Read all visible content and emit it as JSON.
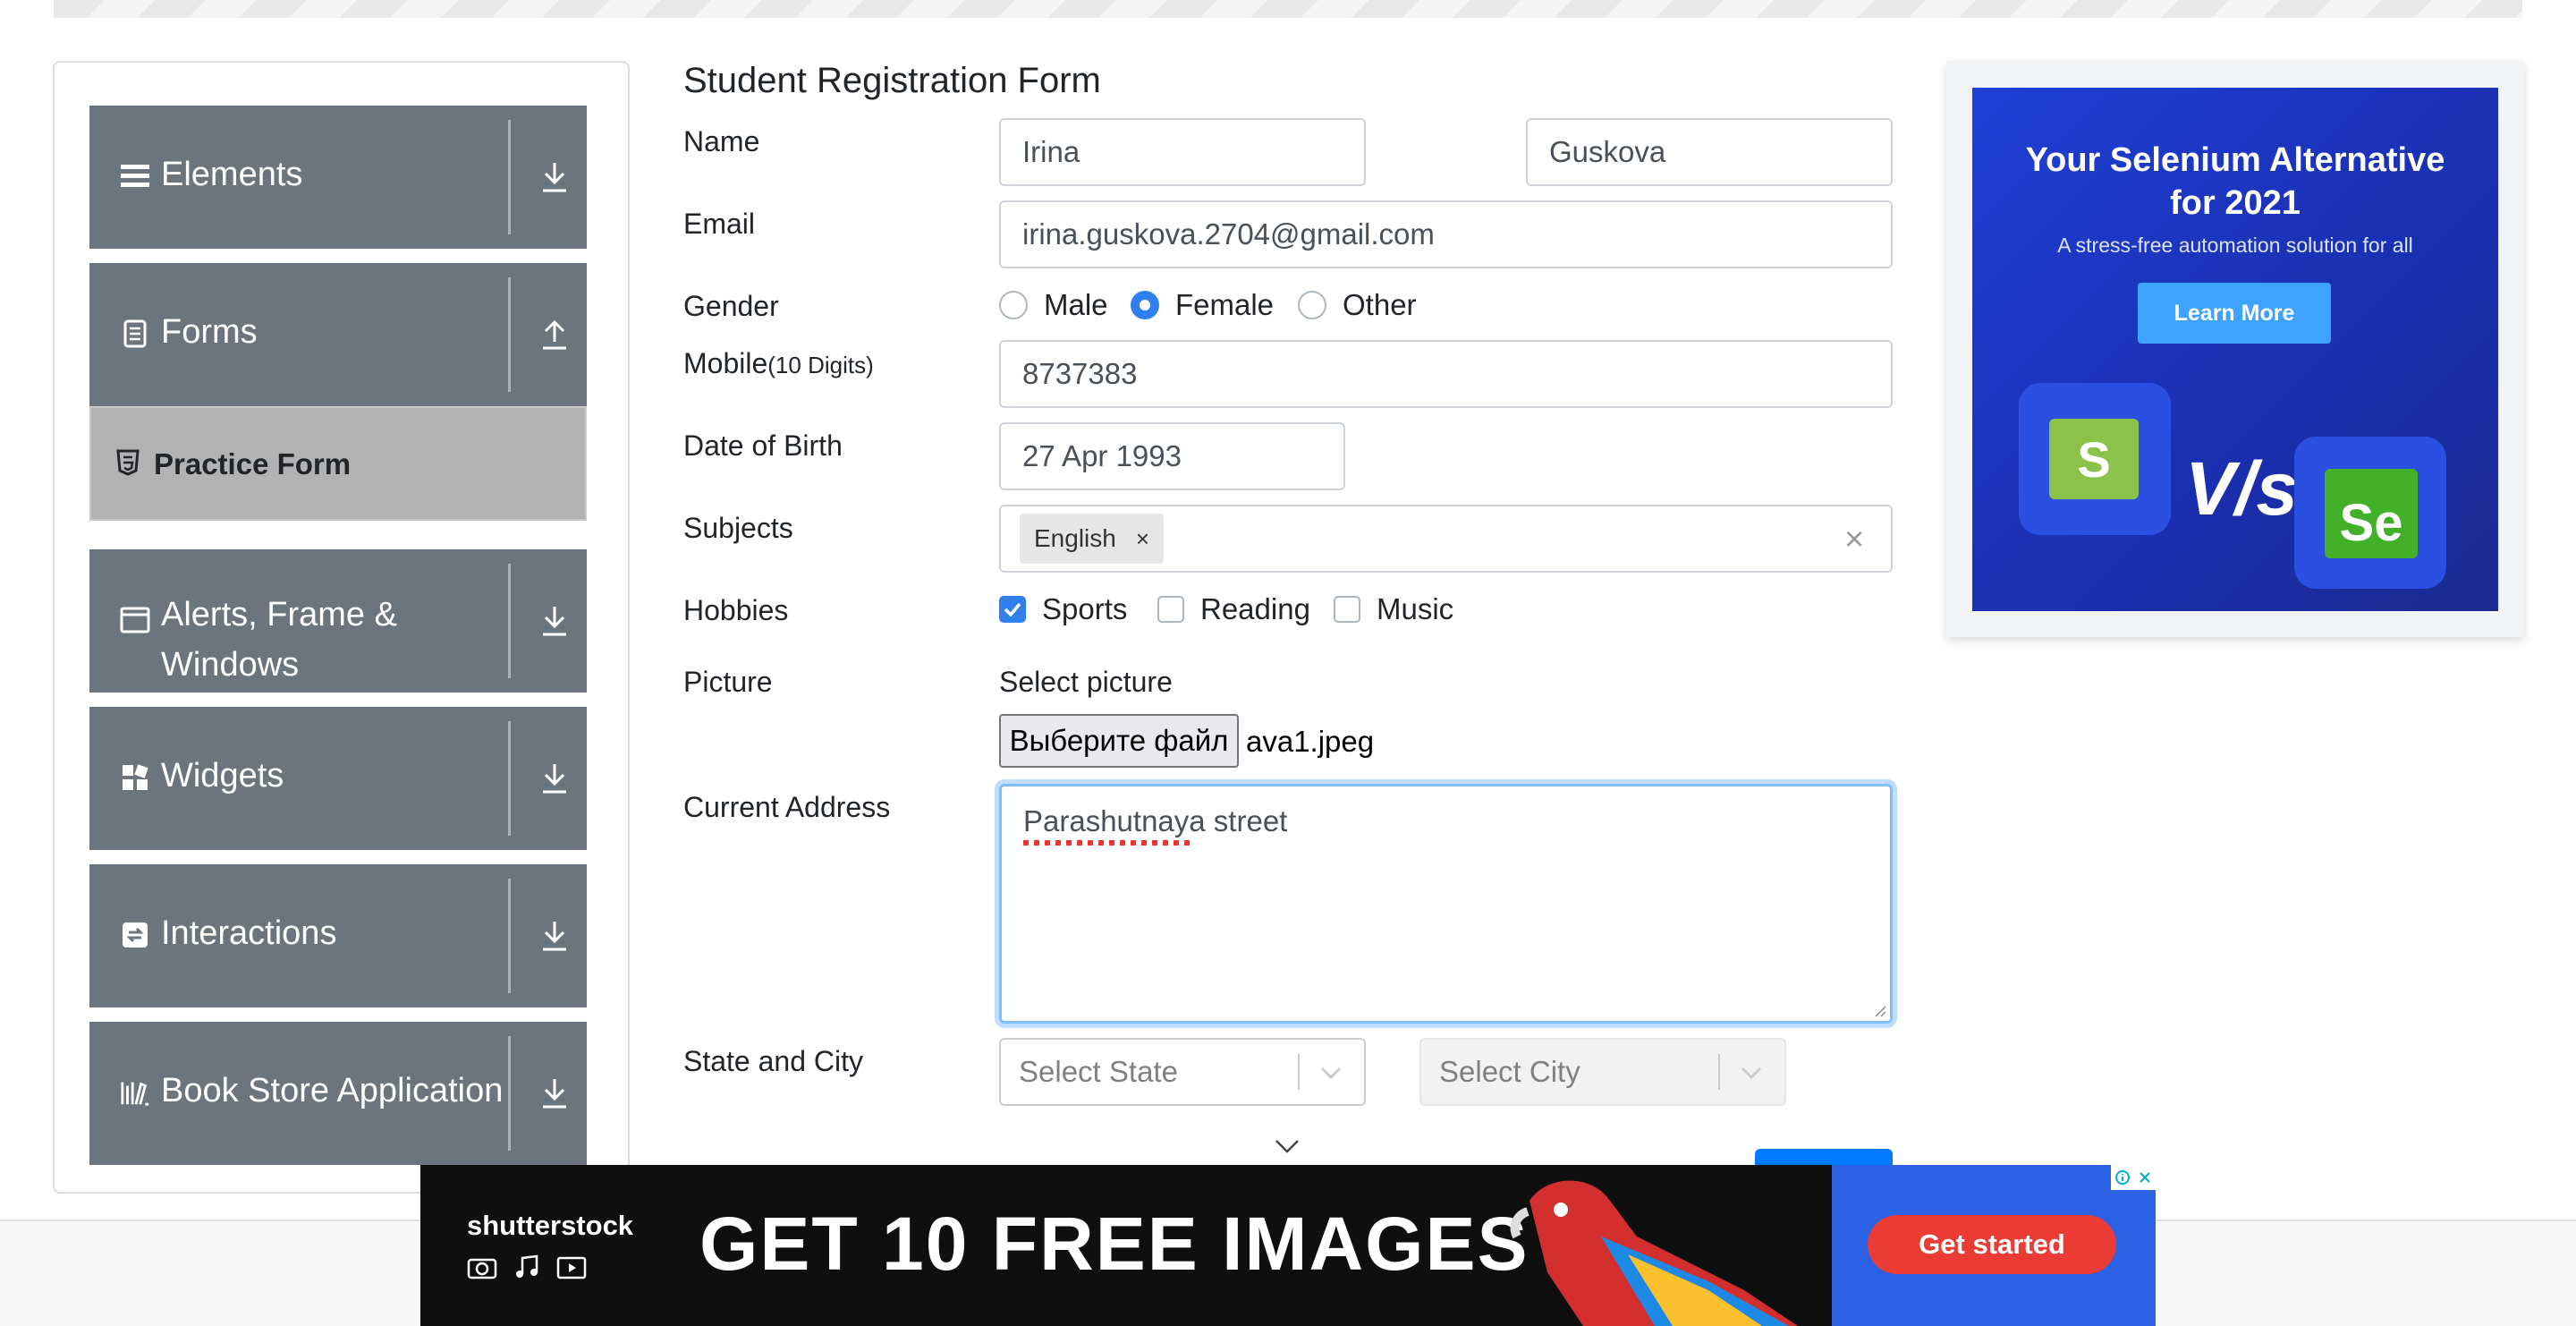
{
  "sidebar": {
    "groups": [
      {
        "label": "Elements",
        "icon": "menu-icon",
        "toggle": "download-icon"
      },
      {
        "label": "Forms",
        "icon": "document-icon",
        "toggle": "upload-icon"
      },
      {
        "label": "Alerts, Frame &",
        "label2": "Windows",
        "icon": "window-icon",
        "toggle": "download-icon"
      },
      {
        "label": "Widgets",
        "icon": "widgets-icon",
        "toggle": "download-icon"
      },
      {
        "label": "Interactions",
        "icon": "interactions-icon",
        "toggle": "download-icon"
      },
      {
        "label": "Book Store Application",
        "icon": "books-icon",
        "toggle": "download-icon"
      }
    ],
    "active_item": "Practice Form"
  },
  "form": {
    "title": "Student Registration Form",
    "name_label": "Name",
    "first_name": "Irina",
    "last_name": "Guskova",
    "email_label": "Email",
    "email": "irina.guskova.2704@gmail.com",
    "gender_label": "Gender",
    "genders": [
      "Male",
      "Female",
      "Other"
    ],
    "gender_selected": "Female",
    "mobile_label": "Mobile",
    "mobile_hint": "(10 Digits)",
    "mobile": "8737383",
    "dob_label": "Date of Birth",
    "dob": "27 Apr 1993",
    "subjects_label": "Subjects",
    "subject_chip": "English",
    "subject_chip_remove": "×",
    "subjects_clear": "×",
    "hobbies_label": "Hobbies",
    "hobbies": [
      "Sports",
      "Reading",
      "Music"
    ],
    "hobbies_checked": [
      "Sports"
    ],
    "picture_label": "Picture",
    "picture_hint": "Select picture",
    "file_button": "Выберите файл",
    "file_name": "ava1.jpeg",
    "address_label": "Current Address",
    "address": "Parashutnaya street",
    "state_city_label": "State and City",
    "state_placeholder": "Select State",
    "city_placeholder": "Select City"
  },
  "ad_right": {
    "headline1": "Your Selenium Alternative",
    "headline2": "for 2021",
    "sub": "A stress-free automation solution for all",
    "button": "Learn More",
    "logo_left": "S",
    "vs": "V/s",
    "logo_right": "Se"
  },
  "ad_bottom": {
    "brand": "shutterstock",
    "headline": "GET 10 FREE IMAGES",
    "button": "Get started"
  },
  "colors": {
    "sidebar": "#6c757d",
    "accent": "#2f80ed",
    "ad_blue": "#1f3fd6",
    "cta_red": "#ea3b34"
  }
}
